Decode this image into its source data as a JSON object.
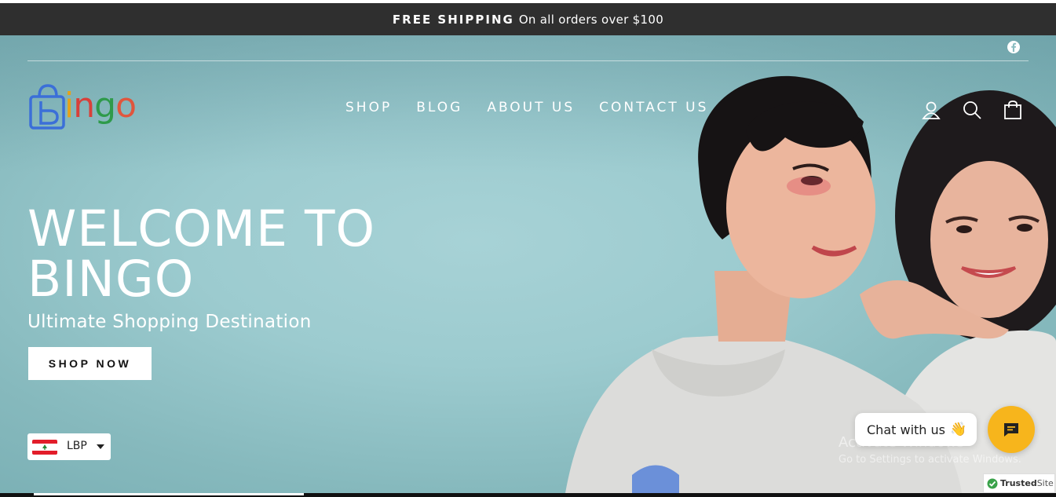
{
  "announcement": {
    "bold": "FREE SHIPPING",
    "text": "On all orders over $100"
  },
  "brand": {
    "logo_text": "ingo",
    "logo_letters": [
      "i",
      "n",
      "g",
      "o"
    ],
    "logo_icon": "shopping-bag-b-icon"
  },
  "nav": {
    "items": [
      {
        "label": "SHOP"
      },
      {
        "label": "BLOG"
      },
      {
        "label": "ABOUT US"
      },
      {
        "label": "CONTACT US"
      }
    ]
  },
  "header_icons": [
    "facebook-icon",
    "account-icon",
    "search-icon",
    "cart-icon"
  ],
  "hero": {
    "title_line1": "WELCOME TO",
    "title_line2": "BINGO",
    "subtitle": "Ultimate Shopping Destination",
    "cta_label": "SHOP NOW"
  },
  "currency": {
    "code": "LBP",
    "flag": "lebanon-flag"
  },
  "overlay": {
    "activate_title": "Activate Windows",
    "activate_text": "Go to Settings to activate Windows."
  },
  "chat": {
    "label": "Chat with us",
    "emoji": "👋"
  },
  "trusted": {
    "bold": "Trusted",
    "rest": "Site"
  },
  "colors": {
    "announcement_bg": "#2f2f2f",
    "hero_bg": "#a7d2d6",
    "chat_button": "#f7b51c",
    "logo_blue": "#3b6fd8"
  }
}
